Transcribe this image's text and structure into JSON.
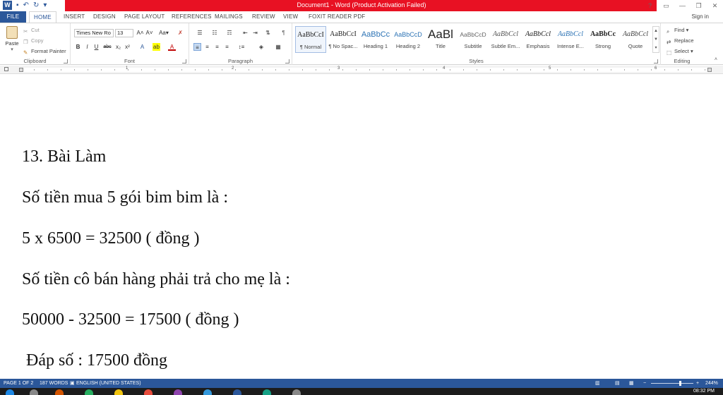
{
  "titlebar": {
    "title": "Document1 - Word (Product Activation Failed)",
    "help": "?",
    "minimize": "—",
    "restore": "❐",
    "close": "✕"
  },
  "tabs": {
    "file": "FILE",
    "home": "HOME",
    "insert": "INSERT",
    "design": "DESIGN",
    "page_layout": "PAGE LAYOUT",
    "references": "REFERENCES",
    "mailings": "MAILINGS",
    "review": "REVIEW",
    "view": "VIEW",
    "foxit": "FOXIT READER PDF",
    "signin": "Sign in"
  },
  "clipboard": {
    "label": "Clipboard",
    "paste": "Paste",
    "cut": "Cut",
    "copy": "Copy",
    "format_painter": "Format Painter"
  },
  "font": {
    "label": "Font",
    "name": "Times New Ro",
    "size": "13"
  },
  "paragraph": {
    "label": "Paragraph"
  },
  "styles": {
    "label": "Styles",
    "items": [
      {
        "preview": "AaBbCcI",
        "name": "¶ Normal"
      },
      {
        "preview": "AaBbCcI",
        "name": "¶ No Spac..."
      },
      {
        "preview": "AaBbCc",
        "name": "Heading 1"
      },
      {
        "preview": "AaBbCcD",
        "name": "Heading 2"
      },
      {
        "preview": "AaBl",
        "name": "Title"
      },
      {
        "preview": "AaBbCcD",
        "name": "Subtitle"
      },
      {
        "preview": "AaBbCcl",
        "name": "Subtle Em..."
      },
      {
        "preview": "AaBbCcl",
        "name": "Emphasis"
      },
      {
        "preview": "AaBbCcl",
        "name": "Intense E..."
      },
      {
        "preview": "AaBbCc",
        "name": "Strong"
      },
      {
        "preview": "AaBbCcl",
        "name": "Quote"
      }
    ]
  },
  "editing": {
    "label": "Editing",
    "find": "Find",
    "replace": "Replace",
    "select": "Select"
  },
  "ruler": {
    "marks": [
      "1",
      "2",
      "3",
      "4",
      "5",
      "6"
    ]
  },
  "document": {
    "lines": [
      "13. Bài Làm",
      "Số tiền mua 5 gói bim bim là :",
      "5 x 6500 = 32500 ( đồng )",
      "Số tiền cô bán hàng phải trả cho mẹ là :",
      "50000 - 32500 = 17500 ( đồng )",
      " Đáp số : 17500 đồng"
    ]
  },
  "status": {
    "page": "PAGE 1 OF 2",
    "words": "187 WORDS",
    "language": "ENGLISH (UNITED STATES)",
    "zoom": "244%"
  },
  "taskbar": {
    "time": "08:32 PM"
  }
}
